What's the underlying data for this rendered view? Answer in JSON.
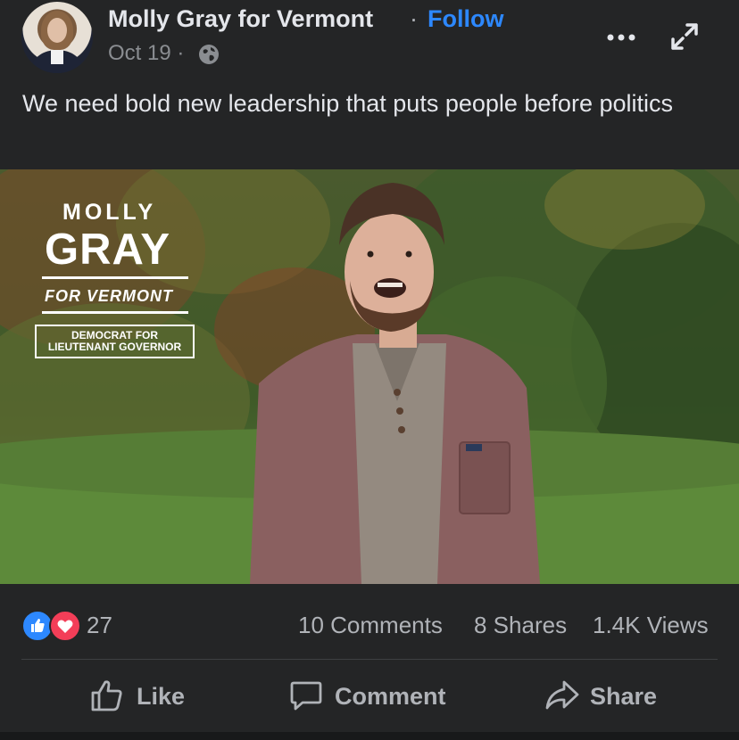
{
  "post": {
    "page_name": "Molly Gray for Vermont",
    "separator": "·",
    "follow_label": "Follow",
    "date": "Oct 19 ·",
    "privacy_icon": "globe-icon",
    "more_icon": "more-options-icon",
    "expand_icon": "expand-icon",
    "text": "We need bold new leadership that puts people before politics"
  },
  "video": {
    "logo_first": "MOLLY",
    "logo_last": "GRAY",
    "logo_for": "FOR VERMONT",
    "logo_office": "DEMOCRAT FOR LIEUTENANT GOVERNOR"
  },
  "stats": {
    "reactions_count": "27",
    "comments": "10 Comments",
    "shares": "8 Shares",
    "views": "1.4K Views"
  },
  "actions": {
    "like": "Like",
    "comment": "Comment",
    "share": "Share"
  },
  "colors": {
    "background": "#242526",
    "link_blue": "#2d88ff",
    "love_red": "#f33e58",
    "muted_text": "#b0b3b8"
  }
}
